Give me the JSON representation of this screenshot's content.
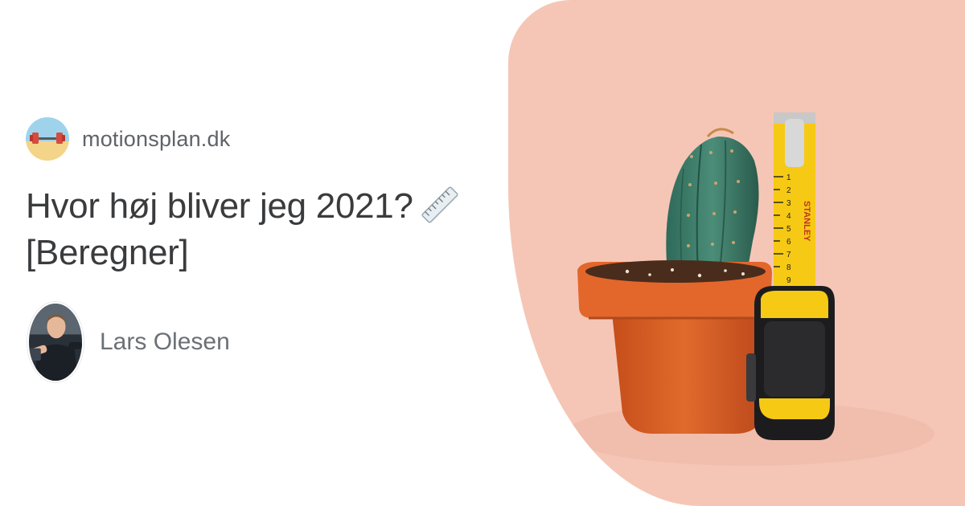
{
  "site": {
    "name": "motionsplan.dk",
    "logo_icon": "dumbbell-beach-logo-icon"
  },
  "article": {
    "title": "Hvor høj bliver jeg 2021?",
    "title_suffix": "[Beregner]",
    "title_icon": "ruler-icon"
  },
  "author": {
    "name": "Lars Olesen",
    "avatar_icon": "author-avatar"
  },
  "hero": {
    "background_color": "#f5c6b6",
    "tape_brand": "STANLEY",
    "tape_numbers": [
      "1",
      "2",
      "3",
      "4",
      "5",
      "6",
      "7",
      "8",
      "9"
    ]
  },
  "colors": {
    "text_dark": "#3a3b3d",
    "text_muted": "#5f6368",
    "pot": "#d2561f",
    "tape_yellow": "#f6c915"
  }
}
